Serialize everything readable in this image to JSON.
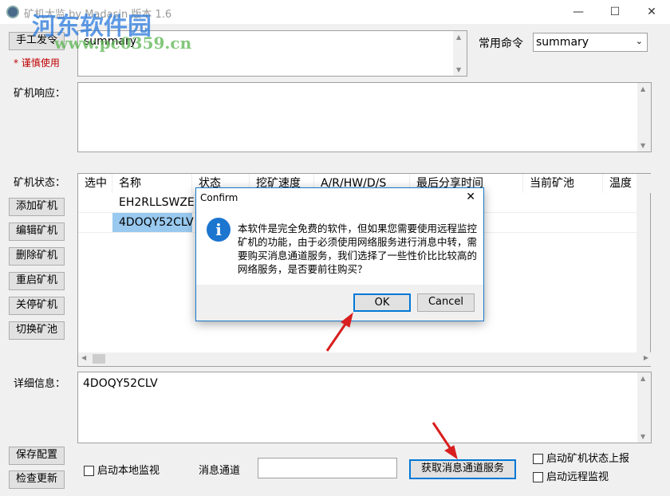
{
  "window": {
    "title": "矿机大监 by Madasin 版本 1.6",
    "minimize": "—",
    "maximize": "☐",
    "close": "✕"
  },
  "watermark": {
    "name": "河东软件园",
    "url": "www.pc0359.cn"
  },
  "command": {
    "send_button": "手工发令",
    "warning": "* 谨慎使用",
    "value": "summary",
    "common_label": "常用命令",
    "common_selected": "summary"
  },
  "response": {
    "label": "矿机响应："
  },
  "status": {
    "label": "矿机状态："
  },
  "side_buttons": [
    "添加矿机",
    "编辑矿机",
    "删除矿机",
    "重启矿机",
    "关停矿机",
    "切换矿池"
  ],
  "table": {
    "columns": [
      "选中",
      "名称",
      "状态",
      "挖矿速度",
      "A/R/HW/D/S",
      "最后分享时间",
      "当前矿池",
      "温度"
    ],
    "rows": [
      {
        "name": "EH2RLLSWZE",
        "selected": false
      },
      {
        "name": "4DOQY52CLV",
        "selected": true
      }
    ]
  },
  "detail": {
    "label": "详细信息：",
    "value": "4DOQY52CLV"
  },
  "bottom": {
    "save": "保存配置",
    "update": "检查更新",
    "local_monitor": "启动本地监视",
    "channel_label": "消息通道",
    "channel_value": "",
    "get_service": "获取消息通道服务",
    "report_status": "启动矿机状态上报",
    "remote_monitor": "启动远程监视"
  },
  "dialog": {
    "title": "Confirm",
    "close": "✕",
    "icon": "info-icon",
    "message": "本软件是完全免费的软件，但如果您需要使用远程监控矿机的功能，由于必须使用网络服务进行消息中转，需要购买消息通道服务，我们选择了一些性价比比较高的网络服务，是否要前往购买？",
    "ok": "OK",
    "cancel": "Cancel"
  },
  "colors": {
    "selection": "#99c9ef",
    "dialog_border": "#1979ca",
    "info": "#1c75cf",
    "warning": "#c00000",
    "arrow": "#d81e1e"
  }
}
